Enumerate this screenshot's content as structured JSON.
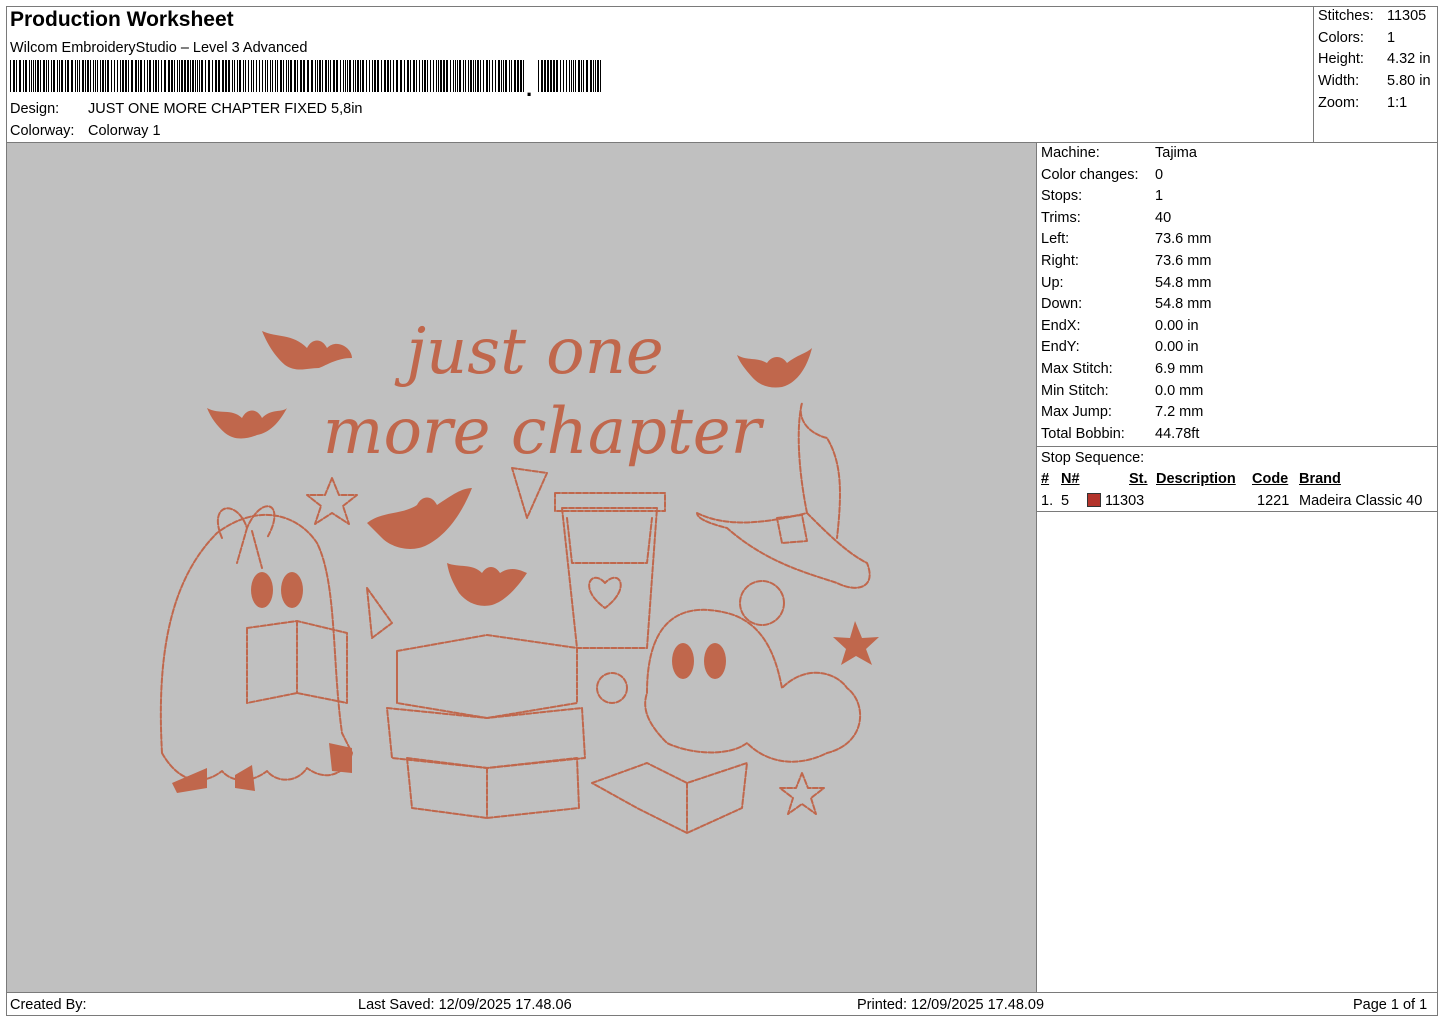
{
  "header": {
    "title": "Production Worksheet",
    "software": "Wilcom EmbroideryStudio – Level 3 Advanced",
    "barcode_suffix": ",",
    "design_label": "Design:",
    "design_value": "JUST ONE MORE CHAPTER FIXED 5,8in",
    "colorway_label": "Colorway:",
    "colorway_value": "Colorway 1"
  },
  "stats": [
    {
      "label": "Stitches:",
      "value": "11305"
    },
    {
      "label": "Colors:",
      "value": "1"
    },
    {
      "label": "Height:",
      "value": "4.32 in"
    },
    {
      "label": "Width:",
      "value": "5.80 in"
    },
    {
      "label": "Zoom:",
      "value": "1:1"
    }
  ],
  "machine_info": [
    {
      "label": "Machine:",
      "value": "Tajima"
    },
    {
      "label": "Color changes:",
      "value": "0"
    },
    {
      "label": "Stops:",
      "value": "1"
    },
    {
      "label": "Trims:",
      "value": "40"
    },
    {
      "label": "Left:",
      "value": "73.6 mm"
    },
    {
      "label": "Right:",
      "value": "73.6 mm"
    },
    {
      "label": "Up:",
      "value": "54.8 mm"
    },
    {
      "label": "Down:",
      "value": "54.8 mm"
    },
    {
      "label": "EndX:",
      "value": "0.00 in"
    },
    {
      "label": "EndY:",
      "value": "0.00 in"
    },
    {
      "label": "Max Stitch:",
      "value": "6.9 mm"
    },
    {
      "label": "Min Stitch:",
      "value": "0.0 mm"
    },
    {
      "label": "Max Jump:",
      "value": "7.2 mm"
    },
    {
      "label": "Total Bobbin:",
      "value": "44.78ft"
    }
  ],
  "stop_sequence": {
    "title": "Stop Sequence:",
    "columns": {
      "num": "#",
      "needle": "N#",
      "stitches": "St.",
      "description": "Description",
      "code": "Code",
      "brand": "Brand"
    },
    "rows": [
      {
        "num": "1.",
        "needle": "5",
        "stitches": "11303",
        "description": "",
        "code": "1221",
        "brand": "Madeira Classic 40",
        "color": "#b3332b"
      }
    ]
  },
  "design_art": {
    "text_line1": "just one",
    "text_line2": "more chapter",
    "thread_color": "#c0674c",
    "background_color": "#c0c0c0"
  },
  "footer": {
    "created_by": "Created By:",
    "last_saved": "Last Saved: 12/09/2025 17.48.06",
    "printed": "Printed: 12/09/2025 17.48.09",
    "page": "Page 1 of 1"
  }
}
